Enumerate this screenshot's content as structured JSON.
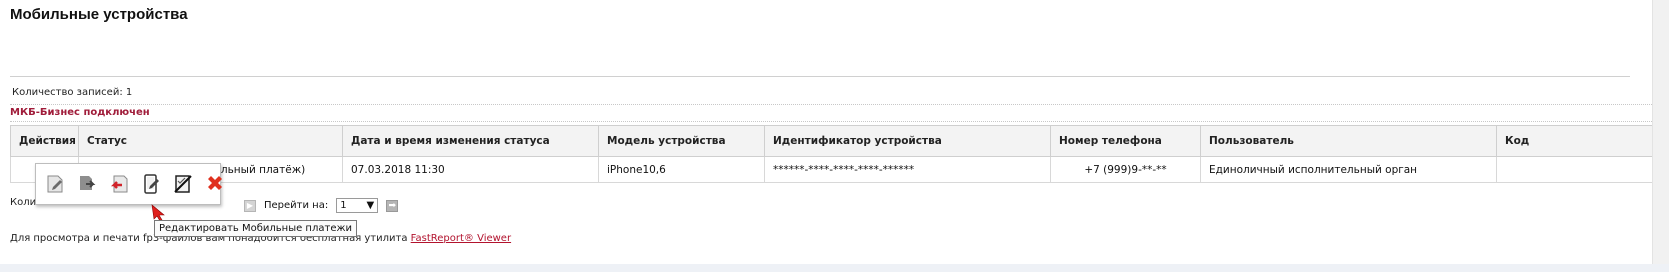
{
  "title": "Мобильные устройства",
  "records_count": "Количество записей: 1",
  "section_title": "МКБ-Бизнес подключен",
  "table": {
    "headers": [
      "Действия",
      "Статус",
      "Дата и время изменения статуса",
      "Модель устройства",
      "Идентификатор устройства",
      "Номер телефона",
      "Пользователь",
      "Код"
    ],
    "rows": [
      {
        "status": "Доступ разрешен (Мобильный платёж)",
        "changed_at": "07.03.2018 11:30",
        "model": "iPhone10,6",
        "device_id": "******-****-****-****-******",
        "phone": "+7 (999)9-**-**",
        "user": "Единоличный исполнительный орган",
        "code": ""
      }
    ]
  },
  "actions_menu": {
    "icons": [
      "edit-doc-icon",
      "forward-doc-icon",
      "return-doc-icon",
      "edit-mobile-payments-icon",
      "block-device-icon",
      "delete-icon"
    ],
    "tooltip": "Редактировать Мобильные платежи"
  },
  "pager": {
    "count_label": "Колич",
    "goto_label": "Перейти на:",
    "page_value": "1",
    "go_symbol": "➡"
  },
  "footer": {
    "text_prefix": "Для просмотра и печати fp3-файлов вам понадобится бесплатная утилита ",
    "link_text": "FastReport® Viewer"
  },
  "colors": {
    "section": "#a01c3a",
    "link": "#b2132e",
    "delete": "#e0301e"
  }
}
